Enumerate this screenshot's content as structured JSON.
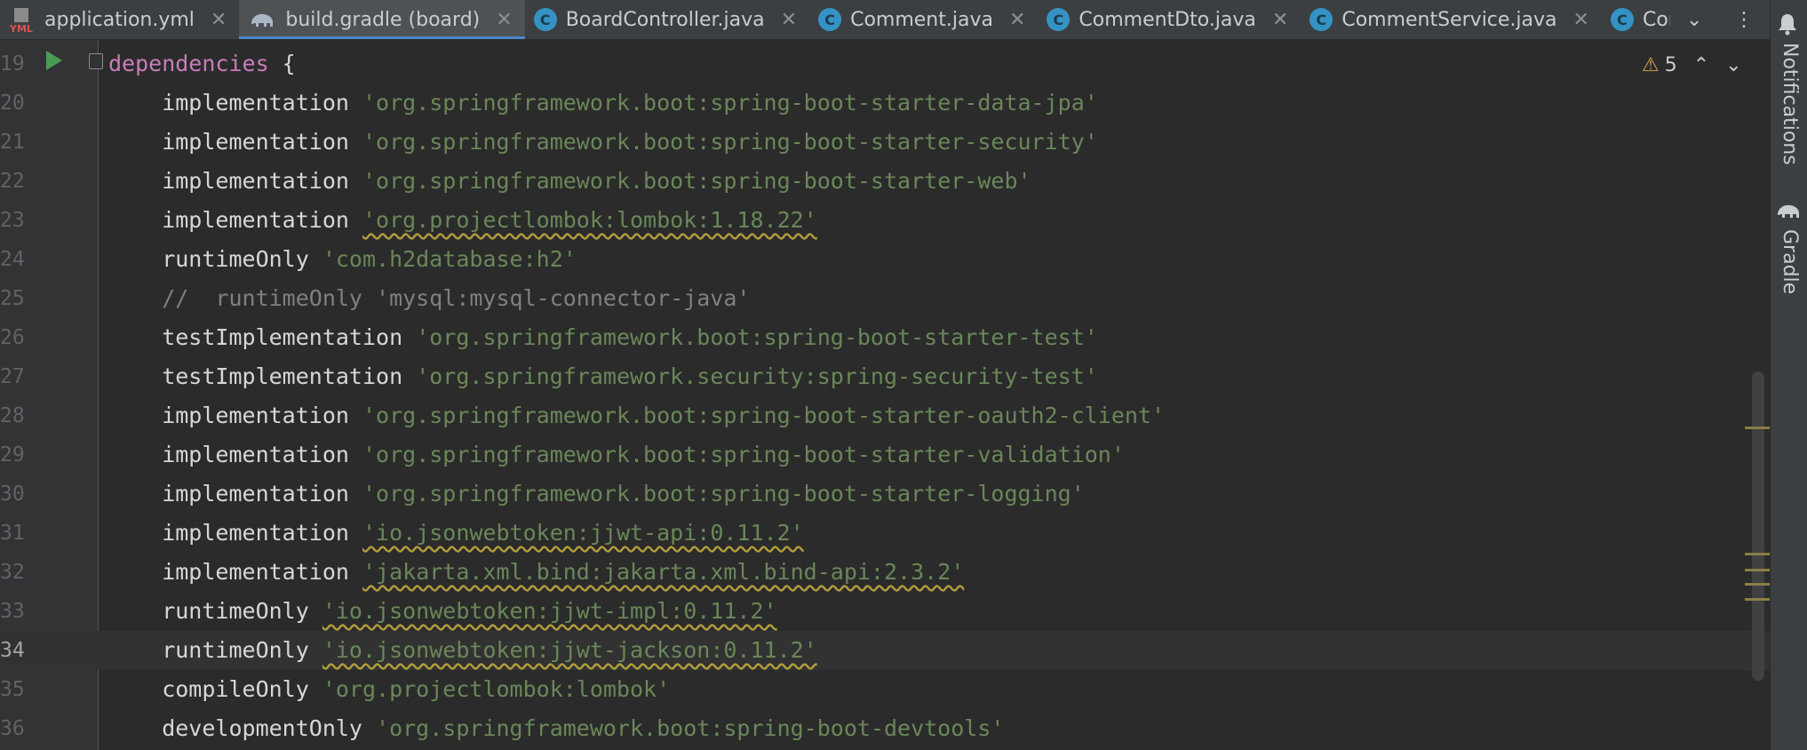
{
  "tabs": [
    {
      "label": "application.yml",
      "icon": "yml-file-icon",
      "active": false,
      "closable": true
    },
    {
      "label": "build.gradle (board)",
      "icon": "gradle-elephant-icon",
      "active": true,
      "closable": true
    },
    {
      "label": "BoardController.java",
      "icon": "java-class-icon",
      "active": false,
      "closable": true
    },
    {
      "label": "Comment.java",
      "icon": "java-class-icon",
      "active": false,
      "closable": true
    },
    {
      "label": "CommentDto.java",
      "icon": "java-class-icon",
      "active": false,
      "closable": true
    },
    {
      "label": "CommentService.java",
      "icon": "java-class-icon",
      "active": false,
      "closable": true
    },
    {
      "label": "Comme",
      "icon": "java-class-icon",
      "active": false,
      "closable": false
    }
  ],
  "tabbar_controls": {
    "dropdown": "⌄",
    "more": "⋮"
  },
  "inspection": {
    "warning_count": "5"
  },
  "tool_windows": {
    "notifications": "Notifications",
    "gradle": "Gradle"
  },
  "editor": {
    "current_line": 34,
    "lines": [
      {
        "n": "19",
        "parts": [
          {
            "t": "dependencies",
            "c": "kw-dep"
          },
          {
            "t": " {",
            "c": "brace"
          }
        ]
      },
      {
        "n": "20",
        "parts": [
          {
            "t": "    implementation ",
            "c": ""
          },
          {
            "t": "'org.springframework.boot:spring-boot-starter-data-jpa'",
            "c": "str"
          }
        ]
      },
      {
        "n": "21",
        "parts": [
          {
            "t": "    implementation ",
            "c": ""
          },
          {
            "t": "'org.springframework.boot:spring-boot-starter-security'",
            "c": "str"
          }
        ]
      },
      {
        "n": "22",
        "parts": [
          {
            "t": "    implementation ",
            "c": ""
          },
          {
            "t": "'org.springframework.boot:spring-boot-starter-web'",
            "c": "str"
          }
        ]
      },
      {
        "n": "23",
        "parts": [
          {
            "t": "    implementation ",
            "c": ""
          },
          {
            "t": "'org.projectlombok:lombok:1.18.22'",
            "c": "str warn"
          }
        ]
      },
      {
        "n": "24",
        "parts": [
          {
            "t": "    runtimeOnly ",
            "c": ""
          },
          {
            "t": "'com.h2database:h2'",
            "c": "str"
          }
        ]
      },
      {
        "n": "25",
        "parts": [
          {
            "t": "    //  runtimeOnly 'mysql:mysql-connector-java'",
            "c": "comment"
          }
        ]
      },
      {
        "n": "26",
        "parts": [
          {
            "t": "    testImplementation ",
            "c": ""
          },
          {
            "t": "'org.springframework.boot:spring-boot-starter-test'",
            "c": "str"
          }
        ]
      },
      {
        "n": "27",
        "parts": [
          {
            "t": "    testImplementation ",
            "c": ""
          },
          {
            "t": "'org.springframework.security:spring-security-test'",
            "c": "str"
          }
        ]
      },
      {
        "n": "28",
        "parts": [
          {
            "t": "    implementation ",
            "c": ""
          },
          {
            "t": "'org.springframework.boot:spring-boot-starter-oauth2-client'",
            "c": "str"
          }
        ]
      },
      {
        "n": "29",
        "parts": [
          {
            "t": "    implementation ",
            "c": ""
          },
          {
            "t": "'org.springframework.boot:spring-boot-starter-validation'",
            "c": "str"
          }
        ]
      },
      {
        "n": "30",
        "parts": [
          {
            "t": "    implementation ",
            "c": ""
          },
          {
            "t": "'org.springframework.boot:spring-boot-starter-logging'",
            "c": "str"
          }
        ]
      },
      {
        "n": "31",
        "parts": [
          {
            "t": "    implementation ",
            "c": ""
          },
          {
            "t": "'io.jsonwebtoken:jjwt-api:0.11.2'",
            "c": "str warn"
          }
        ]
      },
      {
        "n": "32",
        "parts": [
          {
            "t": "    implementation ",
            "c": ""
          },
          {
            "t": "'jakarta.xml.bind:jakarta.xml.bind-api:2.3.2'",
            "c": "str warn"
          }
        ]
      },
      {
        "n": "33",
        "parts": [
          {
            "t": "    runtimeOnly ",
            "c": ""
          },
          {
            "t": "'io.jsonwebtoken:jjwt-impl:0.11.2'",
            "c": "str warn"
          }
        ]
      },
      {
        "n": "34",
        "parts": [
          {
            "t": "    runtimeOnly ",
            "c": ""
          },
          {
            "t": "'io.jsonwebtoken:jjwt-jackson:0.11.2'",
            "c": "str warn"
          }
        ]
      },
      {
        "n": "35",
        "parts": [
          {
            "t": "    compileOnly ",
            "c": ""
          },
          {
            "t": "'org.projectlombok:lombok'",
            "c": "str"
          }
        ]
      },
      {
        "n": "36",
        "parts": [
          {
            "t": "    developmentOnly ",
            "c": ""
          },
          {
            "t": "'org.springframework.boot:spring-boot-devtools'",
            "c": "str"
          }
        ]
      }
    ]
  },
  "colors": {
    "background": "#2b2b2b",
    "string": "#6a8759",
    "keyword": "#c77dbb",
    "tab_active_underline": "#4a88c7",
    "warning": "#d6a64a"
  }
}
